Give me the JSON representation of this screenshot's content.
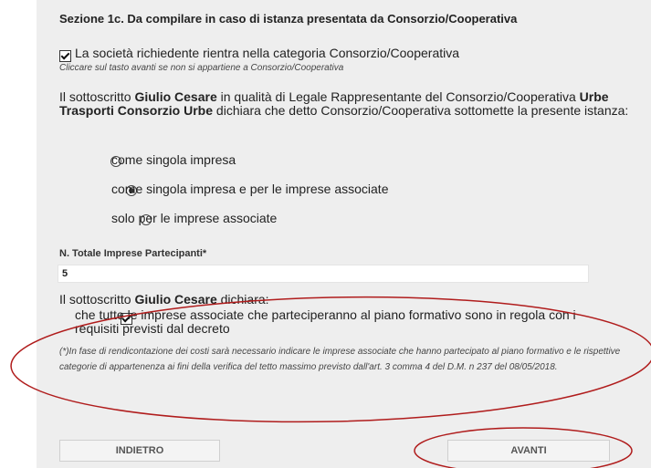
{
  "section": {
    "title": "Sezione 1c. Da compilare in caso di istanza presentata da Consorzio/Cooperativa"
  },
  "consortium_check": {
    "checked": true,
    "label": "La società richiedente rientra nella categoria Consorzio/Cooperativa",
    "hint": "Cliccare sul tasto avanti se non si appartiene a Consorzio/Cooperativa"
  },
  "statement": {
    "prefix": "Il sottoscritto ",
    "name": "Giulio Cesare",
    "middle": " in qualità di Legale Rappresentante del Consorzio/Cooperativa ",
    "org": "Urbe Trasporti Consorzio Urbe",
    "suffix": " dichiara che detto Consorzio/Cooperativa sottomette la presente istanza:"
  },
  "options": [
    {
      "label": "come singola impresa",
      "selected": false
    },
    {
      "label": "come singola impresa e per le imprese associate",
      "selected": true
    },
    {
      "label": "solo per le imprese associate",
      "selected": false
    }
  ],
  "participants": {
    "label": "N. Totale Imprese Partecipanti*",
    "value": "5"
  },
  "declaration": {
    "prefix": "Il sottoscritto ",
    "name": "Giulio Cesare",
    "suffix": " dichiara:",
    "check_checked": true,
    "check_label": "che tutte le imprese associate che parteciperanno al piano formativo sono in regola con i requisiti previsti dal decreto"
  },
  "note": "(*)In fase di rendicontazione dei costi sarà necessario indicare le imprese associate che hanno partecipato al piano formativo e le rispettive categorie di appartenenza ai fini della verifica del tetto massimo previsto dall'art. 3 comma 4 del D.M. n 237 del 08/05/2018.",
  "buttons": {
    "back": "INDIETRO",
    "next": "AVANTI"
  },
  "annotation_color": "#b01c1c"
}
